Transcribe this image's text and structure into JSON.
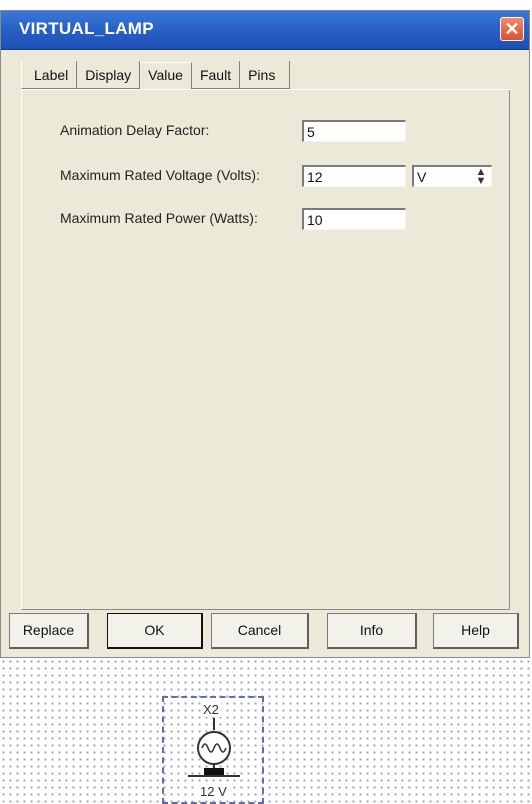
{
  "window": {
    "title": "VIRTUAL_LAMP",
    "close_glyph": "✕"
  },
  "tabs": [
    {
      "label": "Label",
      "active": false
    },
    {
      "label": "Display",
      "active": false
    },
    {
      "label": "Value",
      "active": true
    },
    {
      "label": "Fault",
      "active": false
    },
    {
      "label": "Pins",
      "active": false
    }
  ],
  "fields": {
    "animation_delay": {
      "label": "Animation Delay Factor:",
      "value": "5"
    },
    "max_voltage": {
      "label": "Maximum Rated Voltage (Volts):",
      "value": "12",
      "unit": "V"
    },
    "max_power": {
      "label": "Maximum Rated Power (Watts):",
      "value": "10"
    }
  },
  "buttons": {
    "replace": "Replace",
    "ok": "OK",
    "cancel": "Cancel",
    "info": "Info",
    "help": "Help"
  },
  "schematic": {
    "ref_designator": "X2",
    "value_label": "12 V"
  },
  "colors": {
    "titlebar": "#2a62c8",
    "dialog_bg": "#ece9d8",
    "close_button": "#d9532d"
  },
  "icons": {
    "close": "close-icon",
    "spin": "spin-updown-icon",
    "lamp": "lamp-icon"
  }
}
